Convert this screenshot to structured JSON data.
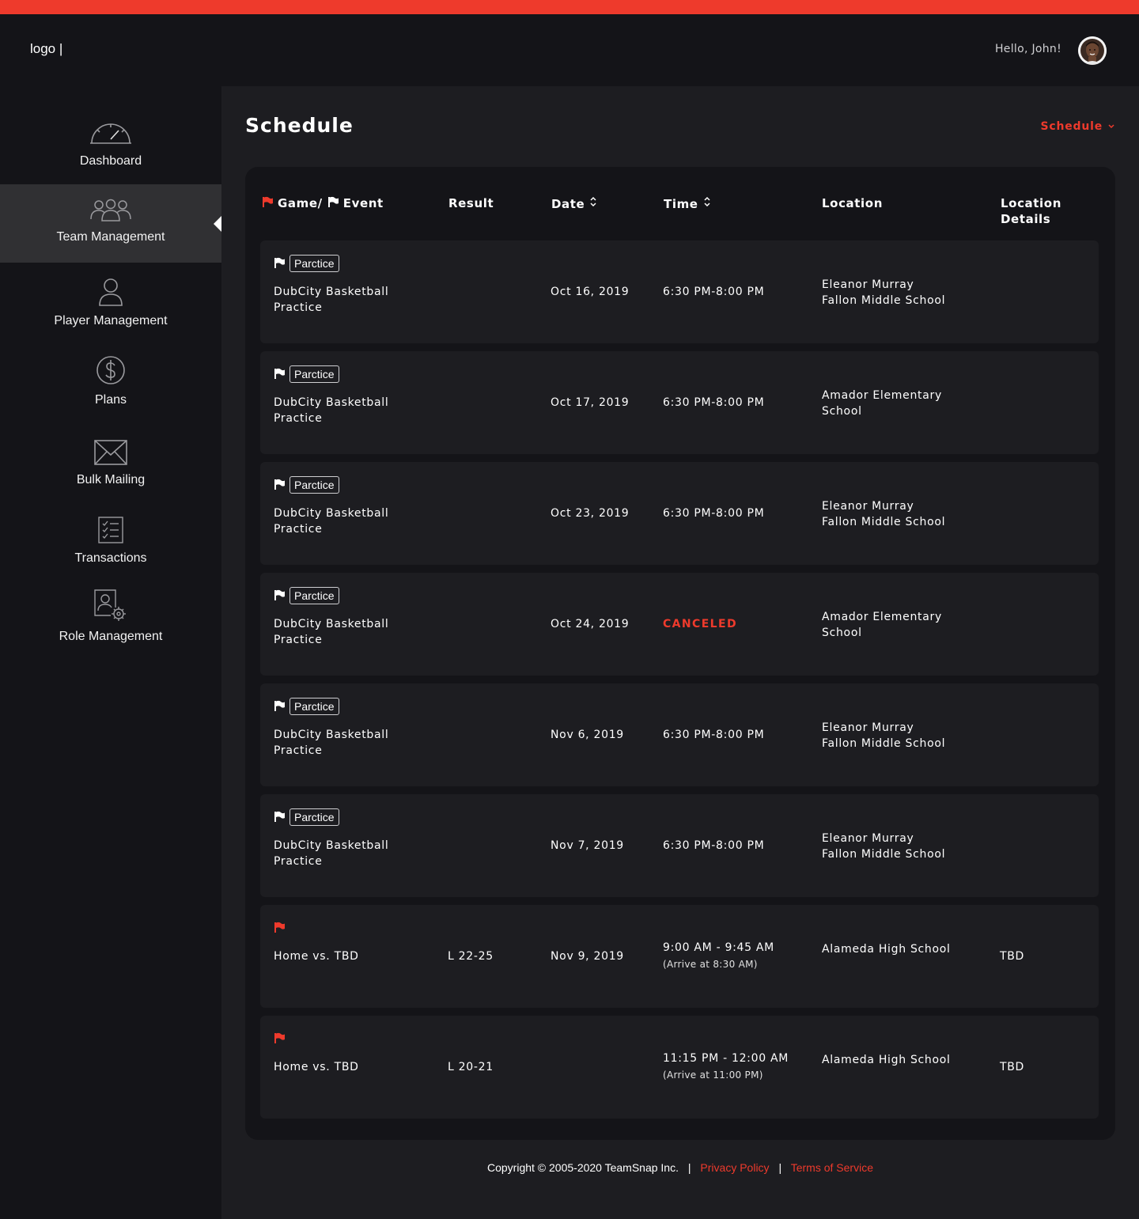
{
  "header": {
    "logo_text": "logo |",
    "greeting": "Hello, John!"
  },
  "sidebar": {
    "items": [
      {
        "label": "Dashboard",
        "icon": "speedometer-icon",
        "active": false
      },
      {
        "label": "Team Management",
        "icon": "team-icon",
        "active": true
      },
      {
        "label": "Player Management",
        "icon": "user-icon",
        "active": false
      },
      {
        "label": "Plans",
        "icon": "dollar-circle-icon",
        "active": false
      },
      {
        "label": "Bulk Mailing",
        "icon": "envelope-icon",
        "active": false
      },
      {
        "label": "Transactions",
        "icon": "checklist-icon",
        "active": false
      },
      {
        "label": "Role Management",
        "icon": "user-gear-icon",
        "active": false
      }
    ]
  },
  "page": {
    "title": "Schedule",
    "view_select": "Schedule"
  },
  "table": {
    "headers": {
      "game_event_game": "Game/",
      "game_event_event": "Event",
      "result": "Result",
      "date": "Date",
      "time": "Time",
      "location": "Location",
      "location_details": "Location Details"
    },
    "rows": [
      {
        "flag": "white",
        "tag": "Parctice",
        "name": "DubCity Basketball Practice",
        "result": "",
        "date": "Oct 16, 2019",
        "time": "6:30 PM-8:00 PM",
        "arrive": "",
        "canceled": false,
        "location": "Eleanor Murray Fallon Middle School",
        "location_details": ""
      },
      {
        "flag": "white",
        "tag": "Parctice",
        "name": "DubCity Basketball Practice",
        "result": "",
        "date": "Oct 17, 2019",
        "time": "6:30 PM-8:00 PM",
        "arrive": "",
        "canceled": false,
        "location": "Amador Elementary School",
        "location_details": ""
      },
      {
        "flag": "white",
        "tag": "Parctice",
        "name": "DubCity Basketball Practice",
        "result": "",
        "date": "Oct 23, 2019",
        "time": "6:30 PM-8:00 PM",
        "arrive": "",
        "canceled": false,
        "location": "Eleanor Murray Fallon Middle School",
        "location_details": ""
      },
      {
        "flag": "white",
        "tag": "Parctice",
        "name": "DubCity Basketball Practice",
        "result": "",
        "date": "Oct 24, 2019",
        "time": "CANCELED",
        "arrive": "",
        "canceled": true,
        "location": "Amador Elementary School",
        "location_details": ""
      },
      {
        "flag": "white",
        "tag": "Parctice",
        "name": "DubCity Basketball Practice",
        "result": "",
        "date": "Nov 6, 2019",
        "time": "6:30 PM-8:00 PM",
        "arrive": "",
        "canceled": false,
        "location": "Eleanor Murray Fallon Middle School",
        "location_details": ""
      },
      {
        "flag": "white",
        "tag": "Parctice",
        "name": "DubCity Basketball Practice",
        "result": "",
        "date": "Nov 7, 2019",
        "time": "6:30 PM-8:00 PM",
        "arrive": "",
        "canceled": false,
        "location": "Eleanor Murray Fallon Middle School",
        "location_details": ""
      },
      {
        "flag": "red",
        "tag": "",
        "name": "Home vs. TBD",
        "result": "L 22-25",
        "date": "Nov 9, 2019",
        "time": "9:00 AM - 9:45 AM",
        "arrive": "(Arrive at 8:30 AM)",
        "canceled": false,
        "location": "Alameda High School",
        "location_details": "TBD"
      },
      {
        "flag": "red",
        "tag": "",
        "name": "Home vs. TBD",
        "result": "L 20-21",
        "date": "",
        "time": "11:15 PM - 12:00 AM",
        "arrive": "(Arrive at 11:00 PM)",
        "canceled": false,
        "location": "Alameda High School",
        "location_details": "TBD"
      }
    ]
  },
  "footer": {
    "copyright": "Copyright © 2005-2020 TeamSnap Inc.",
    "separator": "|",
    "privacy": "Privacy Policy",
    "terms": "Terms of Service"
  },
  "colors": {
    "accent": "#ee3a2c",
    "background": "#1d1d21",
    "panel": "#141418",
    "active_nav": "#303033"
  }
}
